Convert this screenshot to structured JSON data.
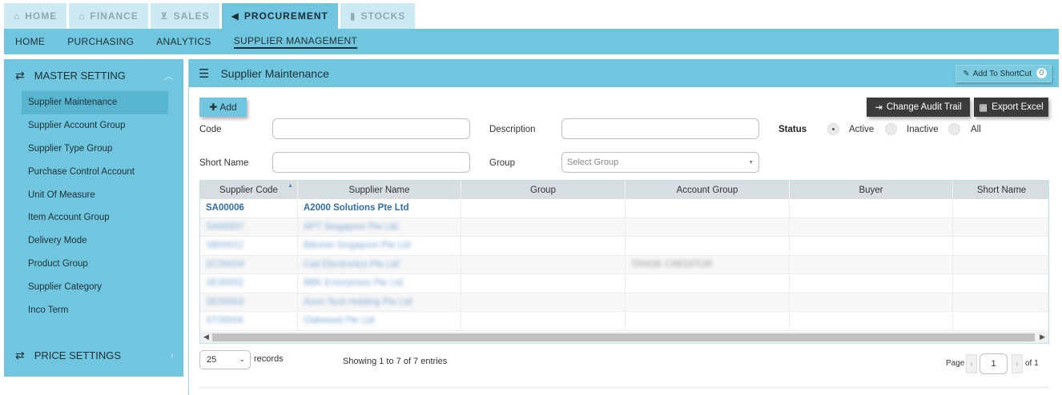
{
  "module_tabs": [
    {
      "label": "HOME",
      "icon": "home-icon",
      "glyph": "⌂"
    },
    {
      "label": "FINANCE",
      "icon": "bank-icon",
      "glyph": "🏛"
    },
    {
      "label": "SALES",
      "icon": "cart-icon",
      "glyph": "🛒"
    },
    {
      "label": "PROCUREMENT",
      "icon": "megaphone-icon",
      "glyph": "📢"
    },
    {
      "label": "STOCKS",
      "icon": "bar-chart-icon",
      "glyph": "▮"
    }
  ],
  "subnav": [
    "HOME",
    "PURCHASING",
    "ANALYTICS",
    "SUPPLIER MANAGEMENT"
  ],
  "sidebar": {
    "master_title": "MASTER SETTING",
    "items": [
      "Supplier Maintenance",
      "Supplier Account Group",
      "Supplier Type Group",
      "Purchase Control Account",
      "Unit Of Measure",
      "Item Account Group",
      "Delivery Mode",
      "Product Group",
      "Supplier Category",
      "Inco Term"
    ],
    "price_title": "PRICE SETTINGS"
  },
  "panel": {
    "title": "Supplier Maintenance",
    "shortcut_label": "Add To ShortCut",
    "shortcut_count": "0",
    "add_label": "Add",
    "audit_label": "Change Audit Trail",
    "export_label": "Export Excel"
  },
  "filters": {
    "code_label": "Code",
    "description_label": "Description",
    "short_name_label": "Short Name",
    "group_label": "Group",
    "group_placeholder": "Select Group",
    "status_label": "Status",
    "status_options": [
      "Active",
      "Inactive",
      "All"
    ],
    "status_selected": "Active"
  },
  "table": {
    "columns": [
      "Supplier Code",
      "Supplier Name",
      "Group",
      "Account Group",
      "Buyer",
      "Short Name"
    ],
    "rows": [
      {
        "code": "SA00006",
        "name": "A2000 Solutions Pte Ltd",
        "account_group": ""
      },
      {
        "code": "SA00007",
        "name": "APT Singapore Pte Ltd",
        "account_group": ""
      },
      {
        "code": "SB00012",
        "name": "Bikonet Singapore Pte Ltd",
        "account_group": ""
      },
      {
        "code": "SC00024",
        "name": "Ciat Electronics Pte Ltd",
        "account_group": "TRADE CREDITOR"
      },
      {
        "code": "SE00002",
        "name": "BBK Enterprises Pte Ltd",
        "account_group": ""
      },
      {
        "code": "SE00003",
        "name": "Azen Tech Holding Pte Ltd",
        "account_group": ""
      },
      {
        "code": "ST00004",
        "name": "Oakwood Pte Ltd",
        "account_group": ""
      }
    ]
  },
  "footer": {
    "page_length": "25",
    "records_label": "records",
    "info": "Showing 1 to 7 of 7 entries",
    "page_label": "Page",
    "page_value": "1",
    "of_label": "of 1"
  }
}
